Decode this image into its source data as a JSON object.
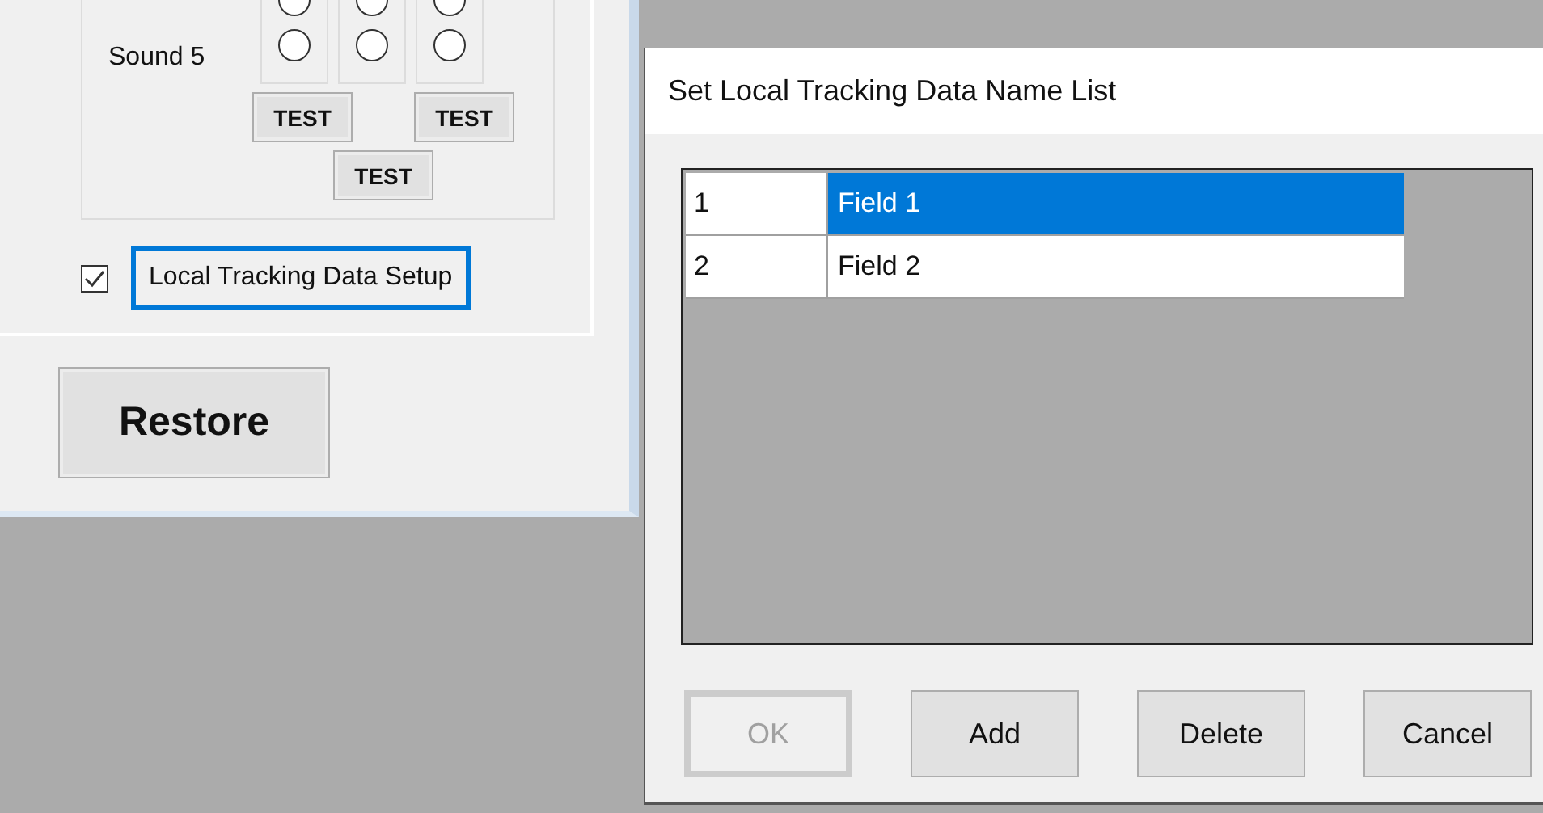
{
  "settings_panel": {
    "radio_columns": [
      {
        "radios": [
          {
            "selected": false
          },
          {
            "selected": false
          }
        ]
      },
      {
        "radios": [
          {
            "selected": false
          },
          {
            "selected": false
          }
        ]
      },
      {
        "radios": [
          {
            "selected": false
          },
          {
            "selected": false
          }
        ]
      }
    ],
    "sound_label": "Sound 5",
    "test_buttons": [
      "TEST",
      "TEST",
      "TEST"
    ],
    "setup_checkbox": {
      "checked": true
    },
    "setup_button": "Local Tracking Data Setup",
    "restore_button": "Restore"
  },
  "dialog": {
    "title": "Set Local Tracking Data Name List",
    "rows": [
      {
        "index": "1",
        "name": "Field 1",
        "selected": true
      },
      {
        "index": "2",
        "name": "Field 2",
        "selected": false
      }
    ],
    "buttons": [
      {
        "label": "OK",
        "disabled": true
      },
      {
        "label": "Add",
        "disabled": false
      },
      {
        "label": "Delete",
        "disabled": false
      },
      {
        "label": "Cancel",
        "disabled": false
      }
    ]
  }
}
